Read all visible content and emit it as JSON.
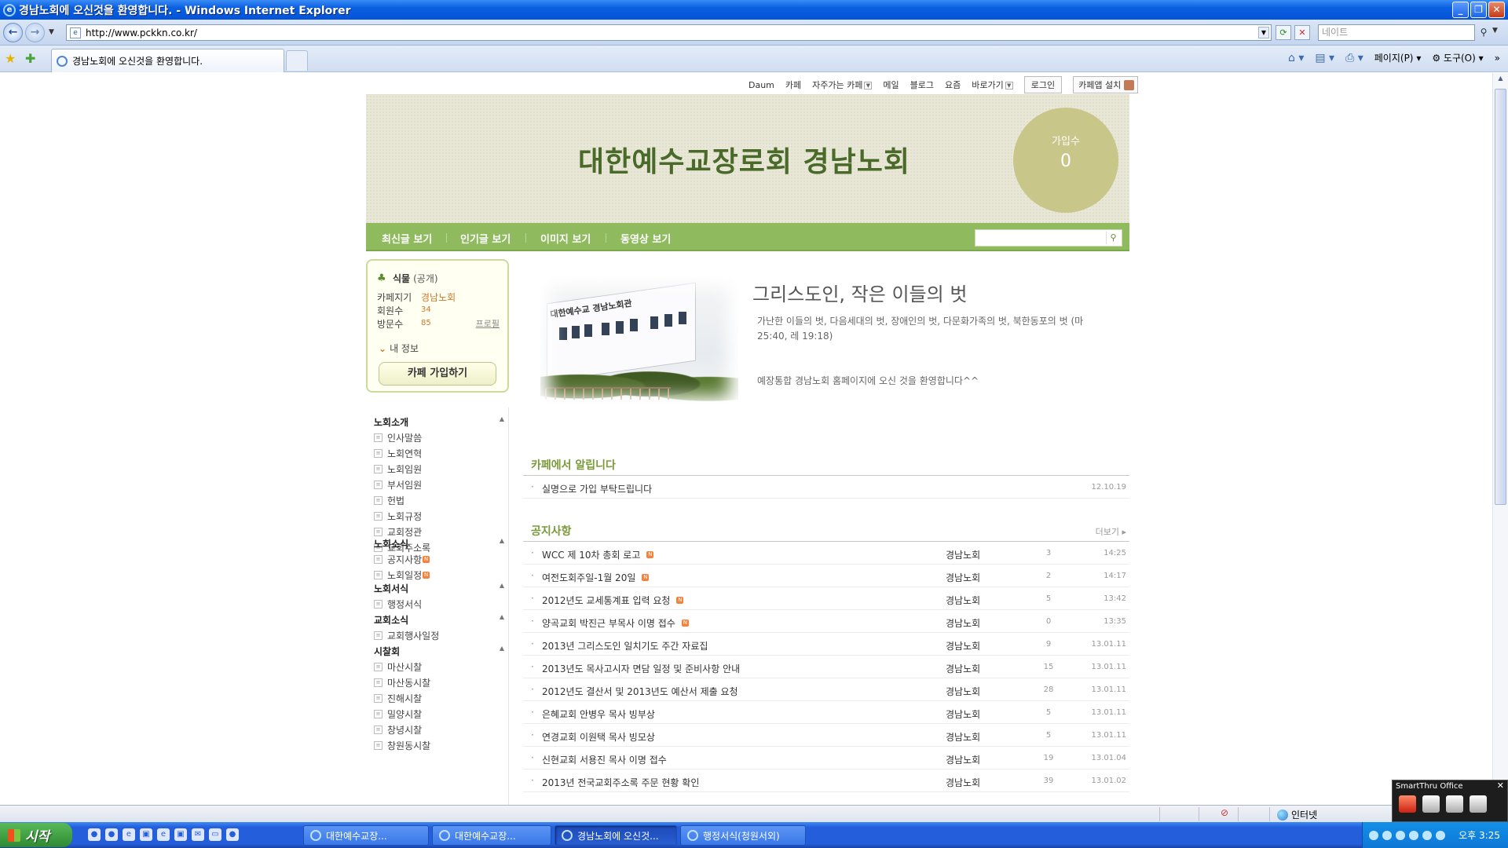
{
  "window": {
    "title": "경남노회에 오신것을 환영합니다. - Windows Internet Explorer",
    "address": "http://www.pckkn.co.kr/",
    "search_placeholder": "네이트",
    "tab_title": "경남노회에 오신것을 환영합니다.",
    "cmd_page": "페이지(P)",
    "cmd_tools": "도구(O)",
    "status_zone": "인터넷"
  },
  "util_nav": {
    "daum": "Daum",
    "cafe": "카페",
    "frequent_cafe": "자주가는 카페",
    "mail": "메일",
    "blog": "블로그",
    "yozm": "요즘",
    "shortcut": "바로가기",
    "login": "로그인",
    "app_install": "카페앱 설치"
  },
  "header": {
    "cafe_name": "대한예수교장로회 경남노회",
    "member_label": "가입수",
    "member_value": "0"
  },
  "menubar": {
    "latest": "최신글 보기",
    "popular": "인기글 보기",
    "images": "이미지 보기",
    "videos": "동영상 보기"
  },
  "profile": {
    "grade": "식물",
    "visibility": "(공개)",
    "manager_label": "카페지기",
    "manager_value": "경남노회",
    "members_label": "회원수",
    "members_value": "34",
    "visits_label": "방문수",
    "visits_value": "85",
    "profile_link": "프로필",
    "my_info": "내 정보",
    "join_button": "카페 가입하기"
  },
  "sidebar": {
    "groups": [
      {
        "title": "노회소개",
        "items": [
          {
            "label": "인사말씀",
            "new": false
          },
          {
            "label": "노회연혁",
            "new": false
          },
          {
            "label": "노회임원",
            "new": false
          },
          {
            "label": "부서임원",
            "new": false
          },
          {
            "label": "헌법",
            "new": false
          },
          {
            "label": "노회규정",
            "new": false
          },
          {
            "label": "교회정관",
            "new": false
          },
          {
            "label": "교회주소록",
            "new": false
          }
        ]
      },
      {
        "title": "노회소식",
        "items": [
          {
            "label": "공지사항",
            "new": true
          },
          {
            "label": "노회일정",
            "new": true
          }
        ]
      },
      {
        "title": "노회서식",
        "items": [
          {
            "label": "행정서식",
            "new": false
          }
        ]
      },
      {
        "title": "교회소식",
        "items": [
          {
            "label": "교회행사일정",
            "new": false
          }
        ]
      },
      {
        "title": "시찰회",
        "items": [
          {
            "label": "마산시찰",
            "new": false
          },
          {
            "label": "마산동시찰",
            "new": false
          },
          {
            "label": "진해시찰",
            "new": false
          },
          {
            "label": "밀양시찰",
            "new": false
          },
          {
            "label": "창녕시찰",
            "new": false
          },
          {
            "label": "창원동시찰",
            "new": false
          }
        ]
      }
    ]
  },
  "welcome": {
    "photo_sign": "대한예수교 경남노회관",
    "title": "그리스도인, 작은 이들의 벗",
    "desc": "가난한 이들의 벗, 다음세대의 벗, 장애인의 벗, 다문화가족의 벗, 북한동포의 벗 (마 25:40, 레 19:18)",
    "message": "예장통합 경남노회 홈페이지에 오신 것을 환영합니다^^"
  },
  "cafe_notice": {
    "title": "카페에서 알립니다",
    "rows": [
      {
        "subject": "실명으로 가입 부탁드립니다",
        "date": "12.10.19"
      }
    ]
  },
  "notice_board": {
    "title": "공지사항",
    "more": "더보기",
    "rows": [
      {
        "subject": "WCC 제 10차 총회 로고",
        "new": true,
        "author": "경남노회",
        "count": "3",
        "date": "14:25"
      },
      {
        "subject": "여전도회주일-1월 20일",
        "new": true,
        "author": "경남노회",
        "count": "2",
        "date": "14:17"
      },
      {
        "subject": "2012년도 교세통계표 입력 요청",
        "new": true,
        "author": "경남노회",
        "count": "5",
        "date": "13:42"
      },
      {
        "subject": "양곡교회 박진근 부목사 이명 접수",
        "new": true,
        "author": "경남노회",
        "count": "0",
        "date": "13:35"
      },
      {
        "subject": "2013년 그리스도인 일치기도 주간 자료집",
        "new": false,
        "author": "경남노회",
        "count": "9",
        "date": "13.01.11"
      },
      {
        "subject": "2013년도 목사고시자 면담 일정 및 준비사항 안내",
        "new": false,
        "author": "경남노회",
        "count": "15",
        "date": "13.01.11"
      },
      {
        "subject": "2012년도 결산서 및 2013년도 예산서 제출 요청",
        "new": false,
        "author": "경남노회",
        "count": "28",
        "date": "13.01.11"
      },
      {
        "subject": "은혜교회 안병우 목사 빙부상",
        "new": false,
        "author": "경남노회",
        "count": "5",
        "date": "13.01.11"
      },
      {
        "subject": "연경교회 이원택 목사 빙모상",
        "new": false,
        "author": "경남노회",
        "count": "5",
        "date": "13.01.11"
      },
      {
        "subject": "신현교회 서용진 목사 이명 접수",
        "new": false,
        "author": "경남노회",
        "count": "19",
        "date": "13.01.04"
      },
      {
        "subject": "2013년 전국교회주소록 주문 현황 확인",
        "new": false,
        "author": "경남노회",
        "count": "39",
        "date": "13.01.02"
      }
    ]
  },
  "taskbar": {
    "start": "시작",
    "tasks": [
      {
        "label": "대한예수교장...",
        "active": false
      },
      {
        "label": "대한예수교장...",
        "active": false
      },
      {
        "label": "경남노회에 오신것...",
        "active": true
      },
      {
        "label": "행정서식(청원서외)",
        "active": false
      }
    ],
    "clock": "오후 3:25",
    "smartthru": "SmartThru Office"
  }
}
